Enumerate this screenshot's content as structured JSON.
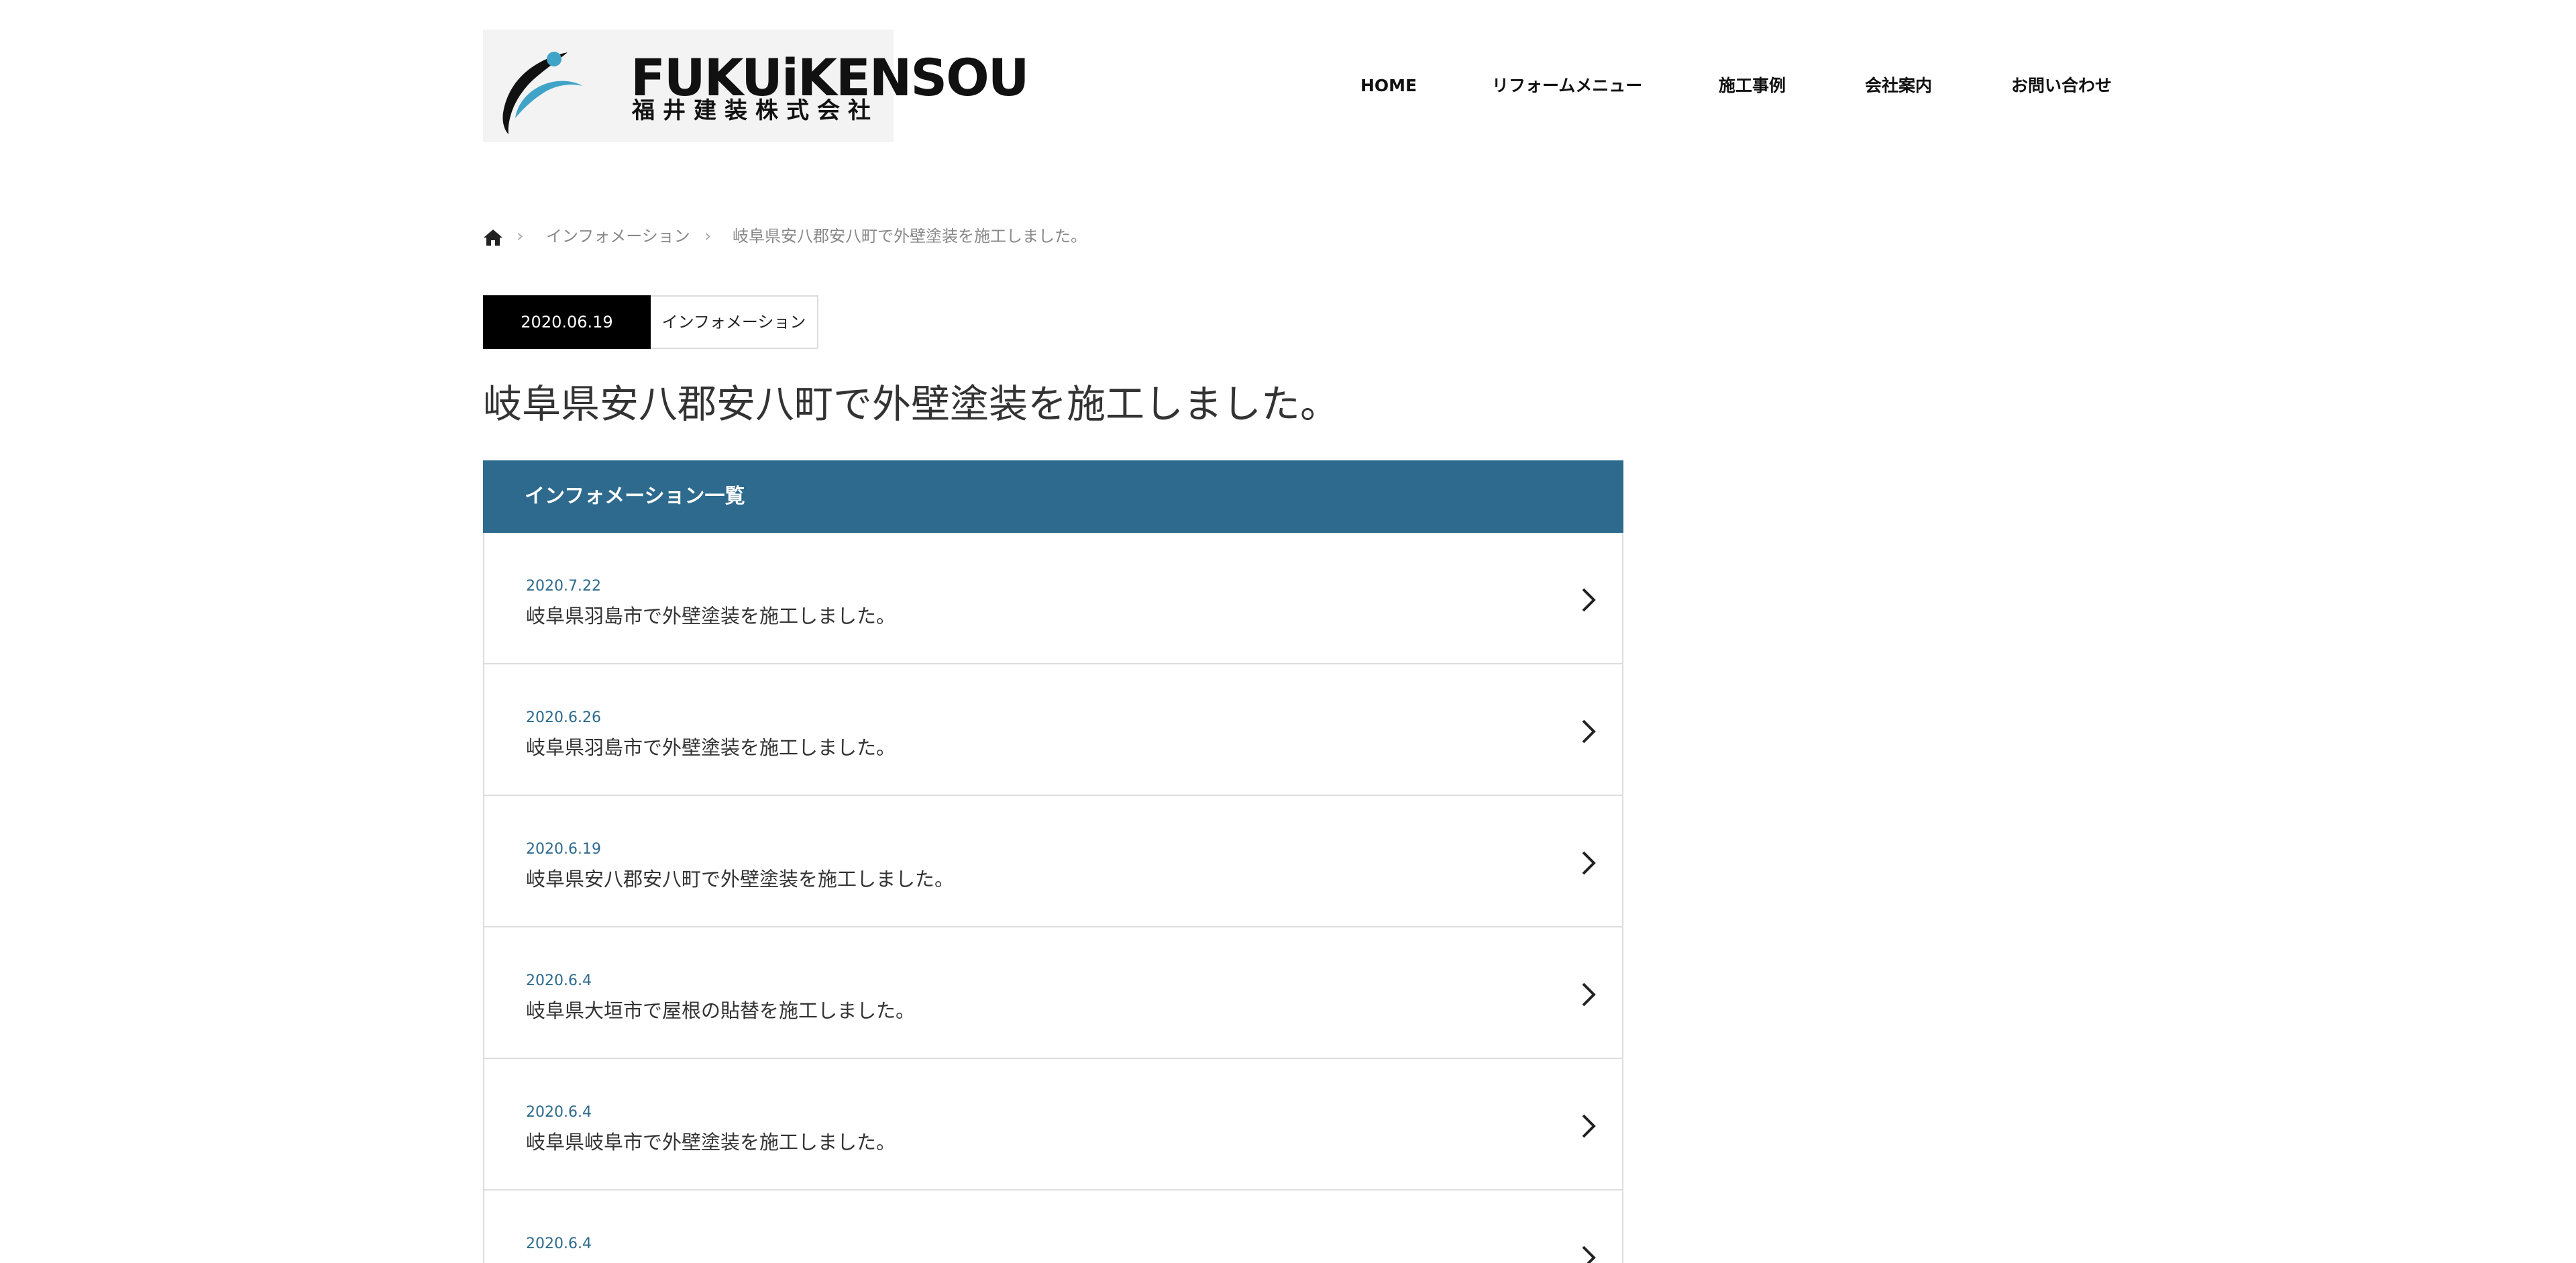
{
  "logo": {
    "name": "FUKUiKENSOU",
    "subtitle": "福井建装株式会社"
  },
  "nav": {
    "items": [
      {
        "label": "HOME"
      },
      {
        "label": "リフォームメニュー"
      },
      {
        "label": "施工事例"
      },
      {
        "label": "会社案内"
      },
      {
        "label": "お問い合わせ"
      }
    ]
  },
  "breadcrumb": {
    "home_icon": "home-icon",
    "separator": "›",
    "items": [
      {
        "label": "インフォメーション"
      },
      {
        "label": "岐阜県安八郡安八町で外壁塗装を施工しました。"
      }
    ]
  },
  "post": {
    "date": "2020.06.19",
    "category": "インフォメーション",
    "title": "岐阜県安八郡安八町で外壁塗装を施工しました。"
  },
  "info_list": {
    "header": "インフォメーション一覧",
    "items": [
      {
        "date": "2020.7.22",
        "title": "岐阜県羽島市で外壁塗装を施工しました。"
      },
      {
        "date": "2020.6.26",
        "title": "岐阜県羽島市で外壁塗装を施工しました。"
      },
      {
        "date": "2020.6.19",
        "title": "岐阜県安八郡安八町で外壁塗装を施工しました。"
      },
      {
        "date": "2020.6.4",
        "title": "岐阜県大垣市で屋根の貼替を施工しました。"
      },
      {
        "date": "2020.6.4",
        "title": "岐阜県岐阜市で外壁塗装を施工しました。"
      },
      {
        "date": "2020.6.4",
        "title": ""
      }
    ]
  },
  "colors": {
    "accent": "#2d6a8e",
    "date_badge": "#000000",
    "logo_mark": "#3fa4c8"
  }
}
